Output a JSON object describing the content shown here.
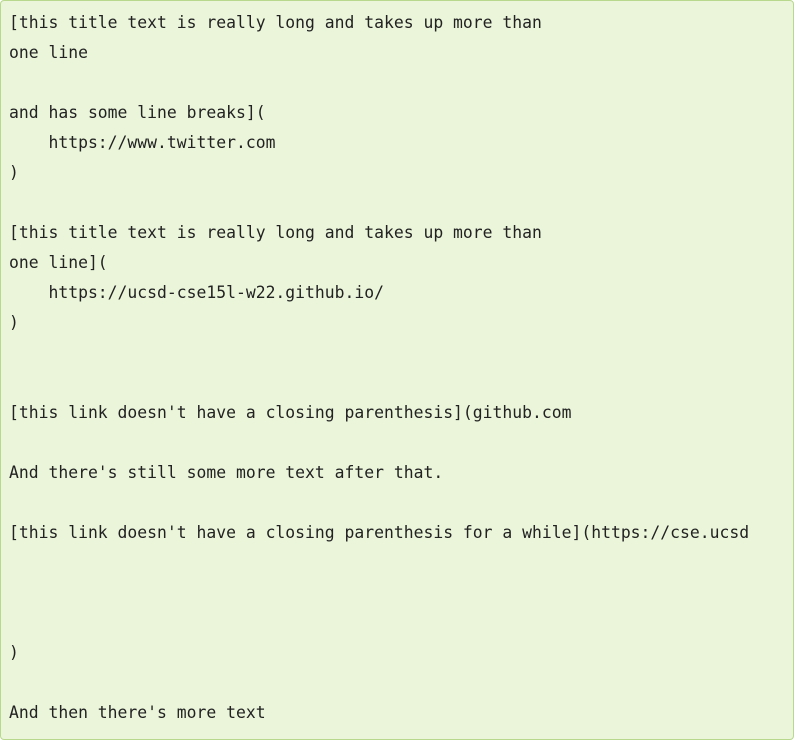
{
  "code_block": {
    "lines": [
      "[this title text is really long and takes up more than",
      "one line",
      "",
      "and has some line breaks](",
      "    https://www.twitter.com",
      ")",
      "",
      "[this title text is really long and takes up more than",
      "one line](",
      "    https://ucsd-cse15l-w22.github.io/",
      ")",
      "",
      "",
      "[this link doesn't have a closing parenthesis](github.com",
      "",
      "And there's still some more text after that.",
      "",
      "[this link doesn't have a closing parenthesis for a while](https://cse.ucsd",
      "",
      "",
      "",
      ")",
      "",
      "And then there's more text"
    ]
  }
}
